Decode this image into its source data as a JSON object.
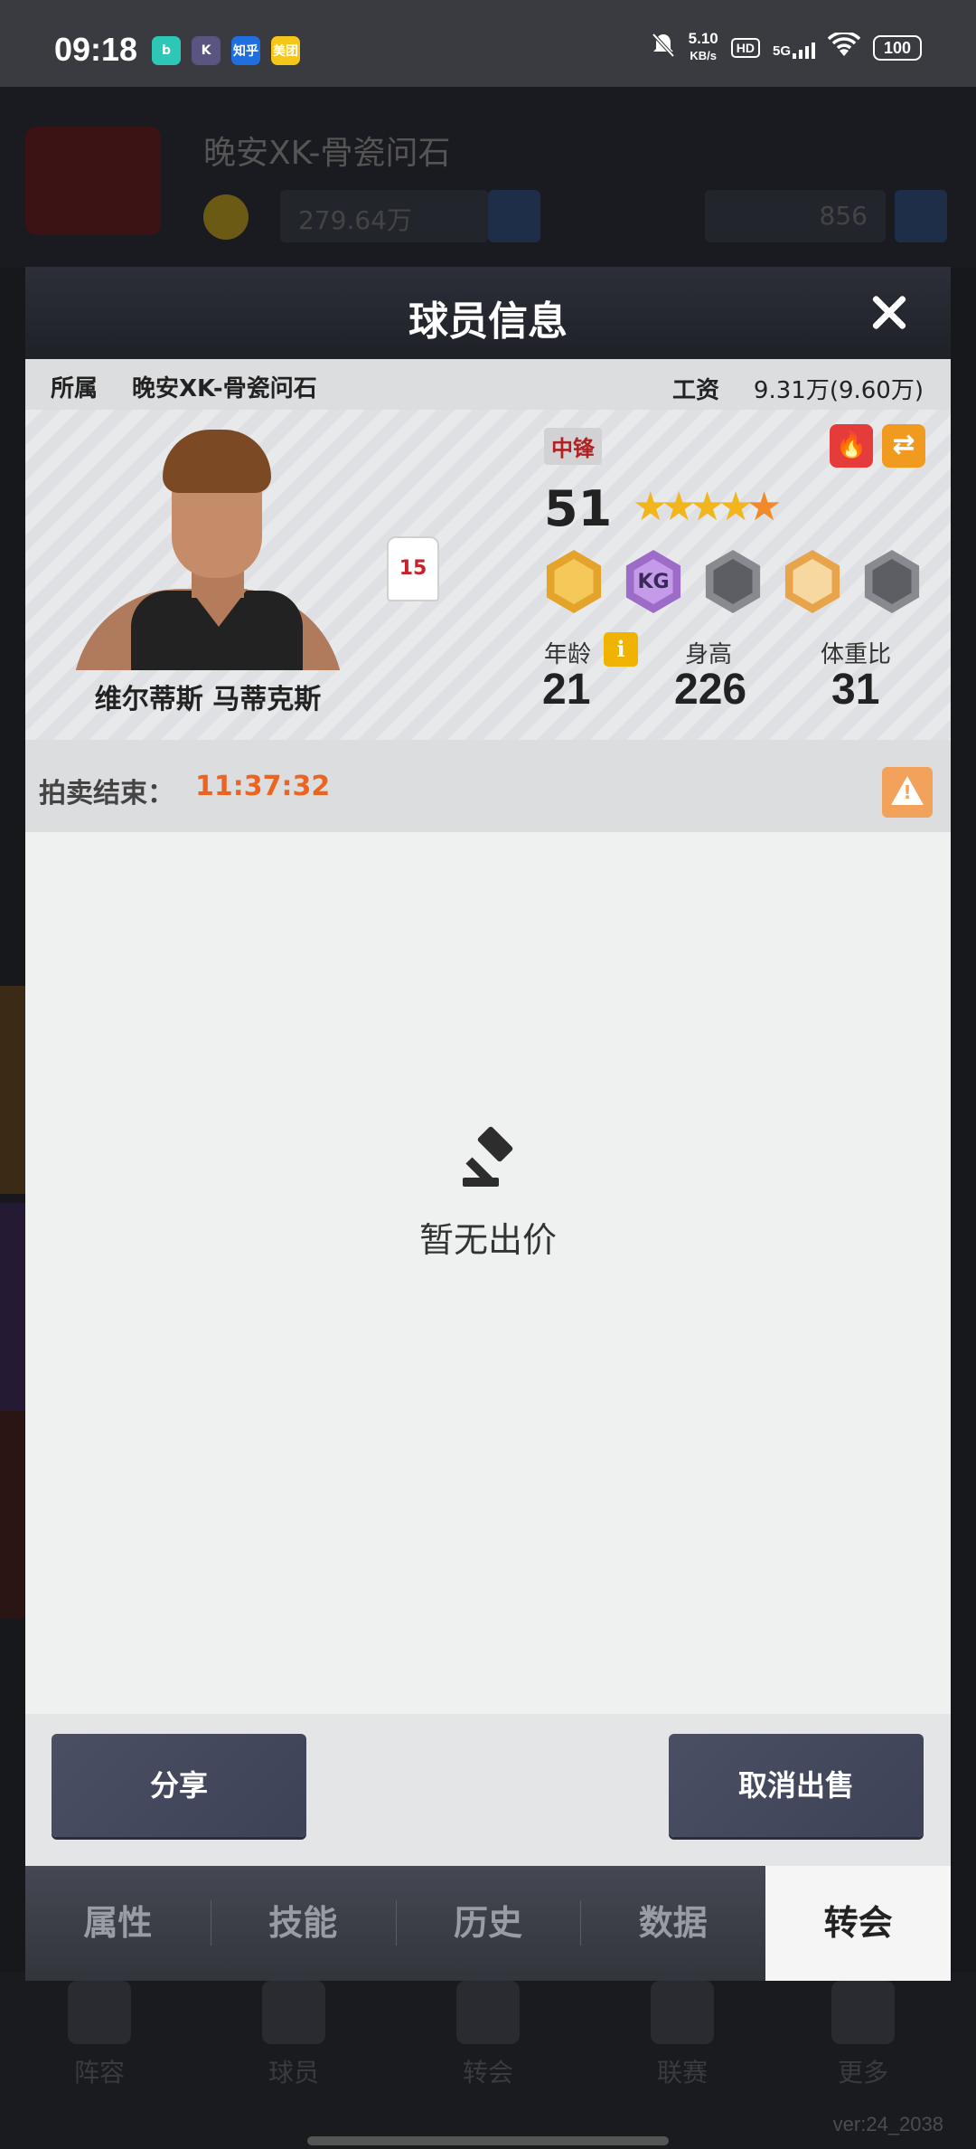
{
  "status_bar": {
    "time": "09:18",
    "apps": [
      {
        "name": "bilibili-app-icon",
        "label": "b",
        "color": "#2ec6b4"
      },
      {
        "name": "k-app-icon",
        "label": "K",
        "color": "#5a5580"
      },
      {
        "name": "zhihu-app-icon",
        "label": "知乎",
        "color": "#1f6fe0"
      },
      {
        "name": "meituan-app-icon",
        "label": "美团",
        "color": "#f5c518"
      }
    ],
    "net_speed": "5.10",
    "net_unit": "KB/s",
    "hd": "HD",
    "signal": "5G",
    "battery": "100"
  },
  "background": {
    "team_name": "晚安XK-骨瓷问石",
    "coins": "279.64万",
    "gems": "856",
    "tabs": [
      "阵容",
      "球员",
      "转会",
      "联赛",
      "更多"
    ],
    "version": "ver:24_2038"
  },
  "modal": {
    "title": "球员信息",
    "affiliation_label": "所属",
    "team": "晚安XK-骨瓷问石",
    "salary_label": "工资",
    "salary": "9.31万(9.60万)",
    "player": {
      "name": "维尔蒂斯 马蒂克斯",
      "jersey_number": "15",
      "position": "中锋",
      "rating": "51",
      "stars": 4.5,
      "age_label": "年龄",
      "age": "21",
      "height_label": "身高",
      "height": "226",
      "weight_label": "体重比",
      "weight": "31",
      "badges": [
        {
          "name": "post-badge-icon",
          "style": "gold",
          "text": ""
        },
        {
          "name": "kg-badge-icon",
          "style": "purple",
          "text": "KG"
        },
        {
          "name": "empty-badge-icon",
          "style": "grey",
          "text": ""
        },
        {
          "name": "wing-badge-icon",
          "style": "orange",
          "text": ""
        },
        {
          "name": "empty-badge-icon",
          "style": "grey",
          "text": ""
        }
      ]
    },
    "auction_label": "拍卖结束：",
    "auction_time": "11:37:32",
    "empty_text": "暂无出价",
    "share_button": "分享",
    "cancel_button": "取消出售",
    "tabs": [
      {
        "label": "属性",
        "active": false
      },
      {
        "label": "技能",
        "active": false
      },
      {
        "label": "历史",
        "active": false
      },
      {
        "label": "数据",
        "active": false
      },
      {
        "label": "转会",
        "active": true
      }
    ]
  }
}
